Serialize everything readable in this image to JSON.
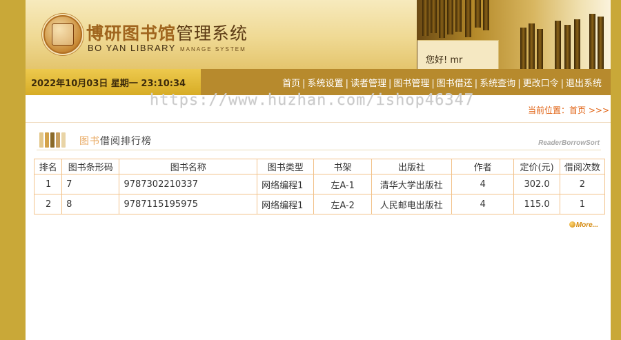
{
  "header": {
    "title_calligraphy": "博研图书馆",
    "title_plain": "管理系统",
    "subtitle": "BO YAN LIBRARY",
    "subtitle_small": "MANAGE SYSTEM",
    "greeting": "您好!   mr"
  },
  "nav": {
    "datetime": "2022年10月03日 星期一 23:10:34",
    "items": [
      {
        "label": "首页"
      },
      {
        "label": "系统设置"
      },
      {
        "label": "读者管理"
      },
      {
        "label": "图书管理"
      },
      {
        "label": "图书借还"
      },
      {
        "label": "系统查询"
      },
      {
        "label": "更改口令"
      },
      {
        "label": "退出系统"
      }
    ]
  },
  "watermark": "https://www.huzhan.com/ishop46347",
  "location": {
    "prefix": "当前位置：",
    "link": "首页",
    "suffix": " >>>"
  },
  "section": {
    "title_prefix": "图书",
    "title": "借阅排行榜",
    "title_en": "ReaderBorrowSort"
  },
  "table": {
    "headers": [
      "排名",
      "图书条形码",
      "图书名称",
      "图书类型",
      "书架",
      "出版社",
      "作者",
      "定价(元)",
      "借阅次数"
    ],
    "rows": [
      [
        "1",
        "7",
        "9787302210337",
        "网络编程1",
        "左A-1",
        "清华大学出版社",
        "4",
        "302.0",
        "2"
      ],
      [
        "2",
        "8",
        "9787115195975",
        "网络编程1",
        "左A-2",
        "人民邮电出版社",
        "4",
        "115.0",
        "1"
      ]
    ]
  },
  "more_label": "More..."
}
